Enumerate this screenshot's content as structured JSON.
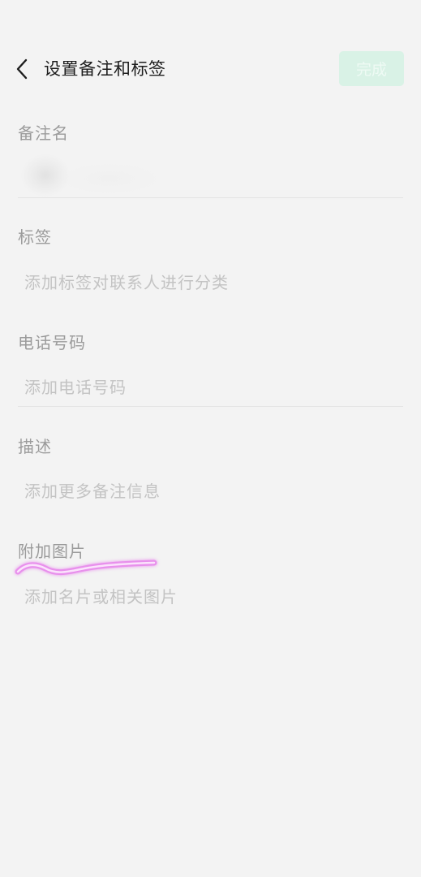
{
  "header": {
    "title": "设置备注和标签",
    "done_label": "完成",
    "back_icon": "chevron-left-icon"
  },
  "form": {
    "remark": {
      "label": "备注名"
    },
    "tags": {
      "label": "标签",
      "placeholder": "添加标签对联系人进行分类"
    },
    "phone": {
      "label": "电话号码",
      "placeholder": "添加电话号码"
    },
    "description": {
      "label": "描述",
      "placeholder": "添加更多备注信息"
    },
    "images": {
      "label": "附加图片",
      "placeholder": "添加名片或相关图片"
    }
  },
  "colors": {
    "background": "#f3f3f3",
    "accent_disabled": "#d9f2e6",
    "marker": "#e040e8"
  }
}
